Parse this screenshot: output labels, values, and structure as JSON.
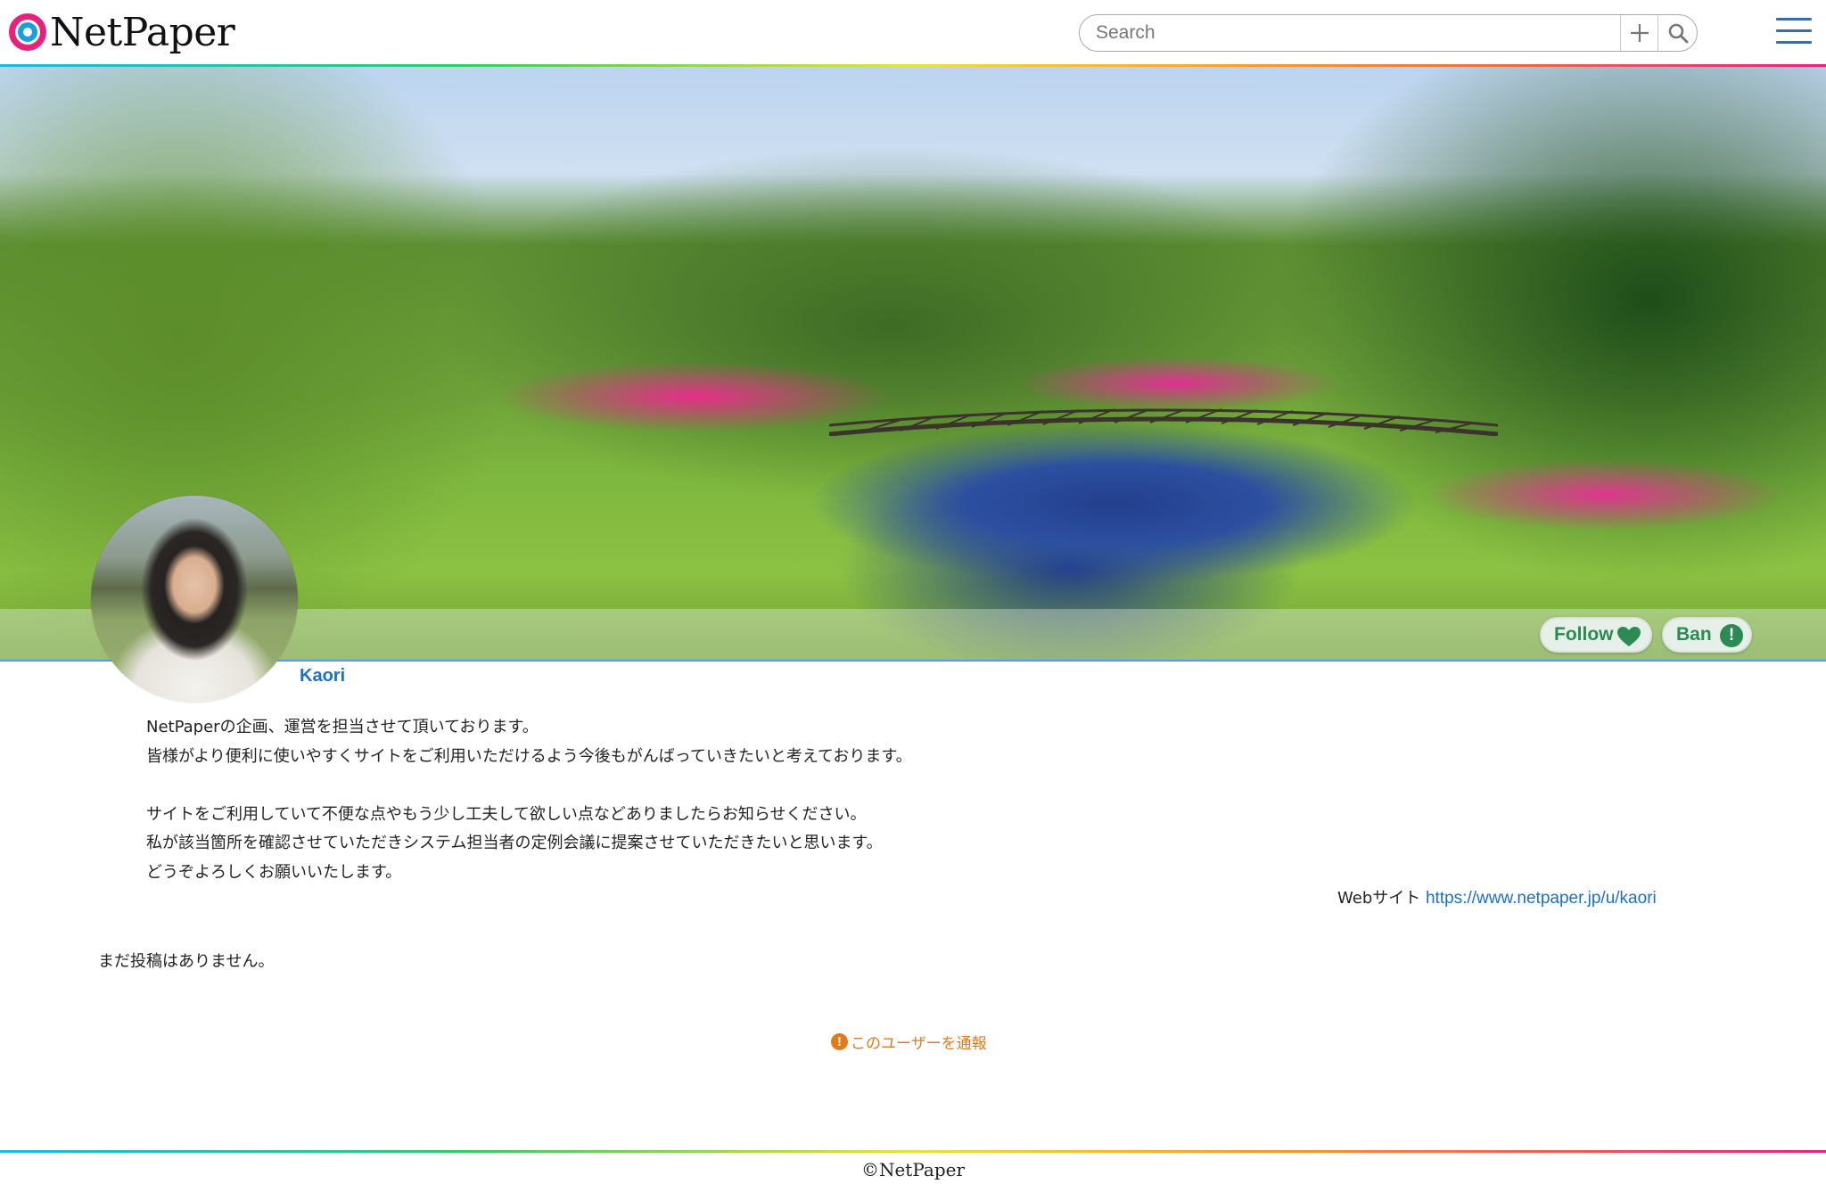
{
  "header": {
    "logo_text": "NetPaper",
    "search_placeholder": "Search"
  },
  "profile": {
    "username": "Kaori",
    "follow_label": "Follow",
    "ban_label": "Ban",
    "ban_icon_glyph": "!",
    "bio_lines": [
      "NetPaperの企画、運営を担当させて頂いております。",
      "皆様がより便利に使いやすくサイトをご利用いただけるよう今後もがんばっていきたいと考えております。",
      "",
      "サイトをご利用していて不便な点やもう少し工夫して欲しい点などありましたらお知らせください。",
      "私が該当箇所を確認させていただきシステム担当者の定例会議に提案させていただきたいと思います。",
      "どうぞよろしくお願いいたします。"
    ],
    "website_label": "Webサイト",
    "website_url": "https://www.netpaper.jp/u/kaori"
  },
  "posts": {
    "empty_message": "まだ投稿はありません。"
  },
  "report": {
    "icon_glyph": "!",
    "label": "このユーザーを通報"
  },
  "footer": {
    "copyright": "©NetPaper"
  },
  "colors": {
    "accent_green": "#2c8a55",
    "link_blue": "#1a6fcf",
    "report_orange": "#e07a1f",
    "logo_pink": "#e8227c",
    "logo_blue": "#1a9fe0"
  },
  "icons": {
    "logo": "netpaper-ring-logo",
    "plus": "plus-icon",
    "search": "search-icon",
    "menu": "hamburger-menu-icon",
    "follow": "heart-icon",
    "ban": "exclamation-icon",
    "report": "exclamation-icon"
  }
}
